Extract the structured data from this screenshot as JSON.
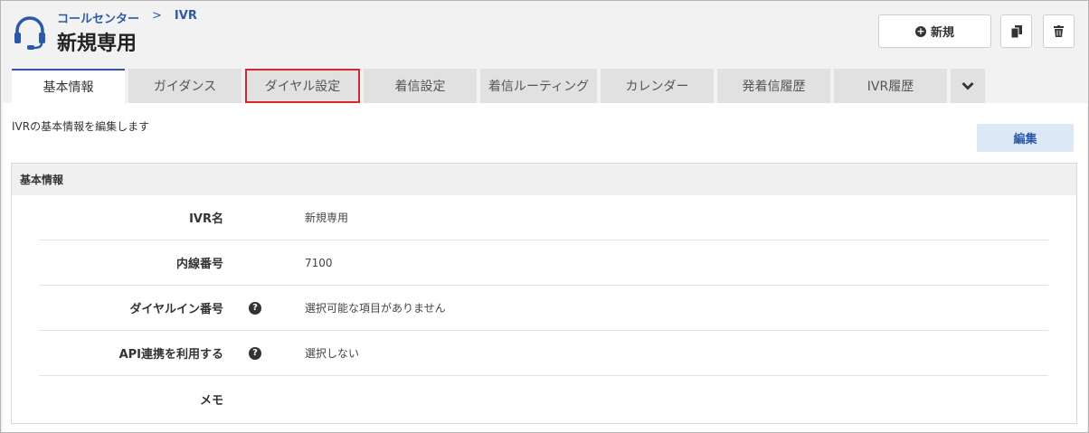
{
  "breadcrumb": {
    "parent": "コールセンター",
    "separator": ">",
    "current": "IVR"
  },
  "page_title": "新規専用",
  "actions": {
    "new_label": "新規",
    "copy_icon": "copy-icon",
    "delete_icon": "trash-icon"
  },
  "tabs": [
    {
      "label": "基本情報",
      "active": true
    },
    {
      "label": "ガイダンス"
    },
    {
      "label": "ダイヤル設定",
      "highlighted": true
    },
    {
      "label": "着信設定"
    },
    {
      "label": "着信ルーティング"
    },
    {
      "label": "カレンダー"
    },
    {
      "label": "発着信履歴"
    },
    {
      "label": "IVR履歴"
    }
  ],
  "description": "IVRの基本情報を編集します",
  "edit_label": "編集",
  "panel": {
    "title": "基本情報",
    "rows": [
      {
        "label": "IVR名",
        "value": "新規専用",
        "help": false
      },
      {
        "label": "内線番号",
        "value": "7100",
        "help": false
      },
      {
        "label": "ダイヤルイン番号",
        "value": "選択可能な項目がありません",
        "help": true
      },
      {
        "label": "API連携を利用する",
        "value": "選択しない",
        "help": true
      },
      {
        "label": "メモ",
        "value": "",
        "help": false
      }
    ]
  },
  "colors": {
    "accent": "#2b59a8",
    "highlight": "#d9262c",
    "tab_bg": "#e1e1e1",
    "edit_bg": "#dde8f7"
  }
}
